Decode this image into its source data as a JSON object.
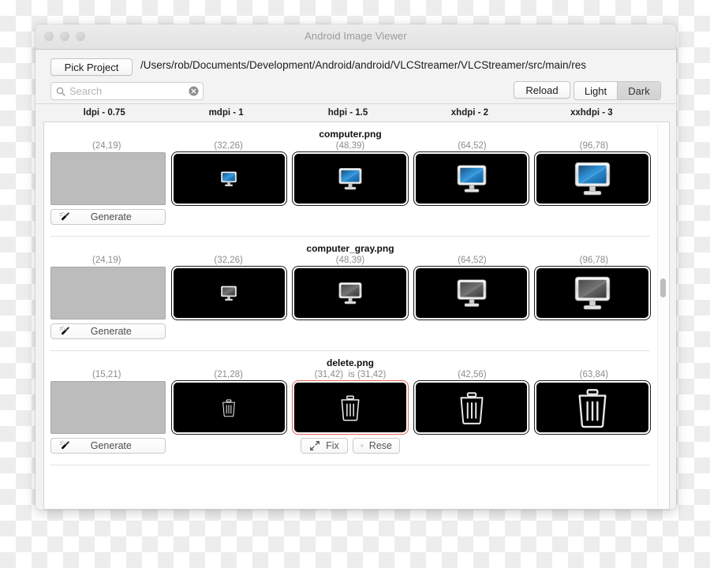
{
  "window": {
    "title": "Android Image Viewer",
    "traffic_lights": [
      "close",
      "minimize",
      "zoom"
    ]
  },
  "toolbar": {
    "pick_project_label": "Pick Project",
    "project_path": "/Users/rob/Documents/Development/Android/android/VLCStreamer/VLCStreamer/src/main/res",
    "search": {
      "placeholder": "Search",
      "value": "",
      "icon": "search-icon",
      "clear_icon": "clear-icon"
    },
    "reload_label": "Reload",
    "theme": {
      "options": [
        "Light",
        "Dark"
      ],
      "selected": "Dark"
    }
  },
  "columns": [
    {
      "label": "ldpi - 0.75"
    },
    {
      "label": "mdpi - 1"
    },
    {
      "label": "hdpi - 1.5"
    },
    {
      "label": "xhdpi - 2"
    },
    {
      "label": "xxhdpi - 3"
    }
  ],
  "buttons": {
    "generate_label": "Generate",
    "generate_icon": "magic-wand-icon",
    "fix_label": "Fix",
    "fix_icon": "resize-arrows-icon",
    "reset_label": "Rese",
    "reset_icon": "refresh-icon"
  },
  "assets": [
    {
      "name": "computer.png",
      "icon": "computer-blue-icon",
      "cells": [
        {
          "dim": "(24,19)",
          "state": "missing",
          "action": "generate"
        },
        {
          "dim": "(32,26)",
          "state": "present",
          "action": "none"
        },
        {
          "dim": "(48,39)",
          "state": "present",
          "action": "none"
        },
        {
          "dim": "(64,52)",
          "state": "present",
          "action": "none"
        },
        {
          "dim": "(96,78)",
          "state": "present",
          "action": "none"
        }
      ]
    },
    {
      "name": "computer_gray.png",
      "icon": "computer-gray-icon",
      "cells": [
        {
          "dim": "(24,19)",
          "state": "missing",
          "action": "generate"
        },
        {
          "dim": "(32,26)",
          "state": "present",
          "action": "none"
        },
        {
          "dim": "(48,39)",
          "state": "present",
          "action": "none"
        },
        {
          "dim": "(64,52)",
          "state": "present",
          "action": "none"
        },
        {
          "dim": "(96,78)",
          "state": "present",
          "action": "none"
        }
      ]
    },
    {
      "name": "delete.png",
      "icon": "trash-icon",
      "cells": [
        {
          "dim": "(15,21)",
          "state": "missing",
          "action": "generate"
        },
        {
          "dim": "(21,28)",
          "state": "present",
          "action": "none"
        },
        {
          "dim": "(31,42)",
          "dim_suffix": "is (31,42)",
          "state": "error",
          "action": "fixreset"
        },
        {
          "dim": "(42,56)",
          "state": "present",
          "action": "none"
        },
        {
          "dim": "(63,84)",
          "state": "present",
          "action": "none"
        }
      ]
    }
  ],
  "colors": {
    "error_border": "#e8625c",
    "tile_background": "#000000",
    "missing_placeholder": "#bcbcbc",
    "screen_blue": "#2a8fd4"
  },
  "scrollbar": {
    "orientation": "vertical",
    "thumb_position": "middle"
  }
}
